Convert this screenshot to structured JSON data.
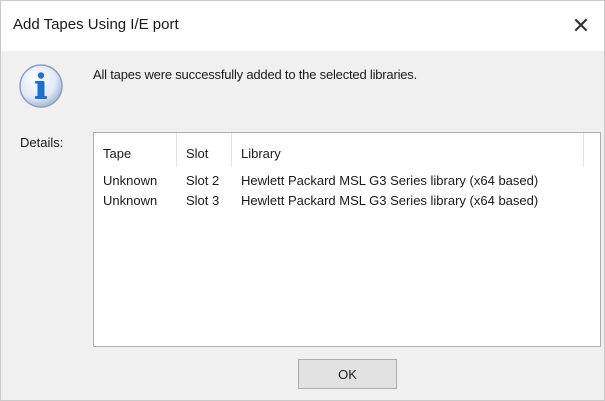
{
  "window": {
    "title": "Add Tapes Using I/E port",
    "close_glyph": "✕"
  },
  "icon": "info-icon",
  "message": "All tapes were successfully added to the selected libraries.",
  "details": {
    "label": "Details:",
    "columns": [
      "Tape",
      "Slot",
      "Library"
    ],
    "rows": [
      {
        "tape": "Unknown",
        "slot": "Slot 2",
        "library": "Hewlett Packard MSL G3 Series library  (x64 based)"
      },
      {
        "tape": "Unknown",
        "slot": "Slot 3",
        "library": "Hewlett Packard MSL G3 Series library  (x64 based)"
      }
    ]
  },
  "ok_label": "OK",
  "colors": {
    "info_blue": "#1f6fd0",
    "dialog_bg": "#f0f0f0",
    "button_bg": "#e1e1e1"
  }
}
